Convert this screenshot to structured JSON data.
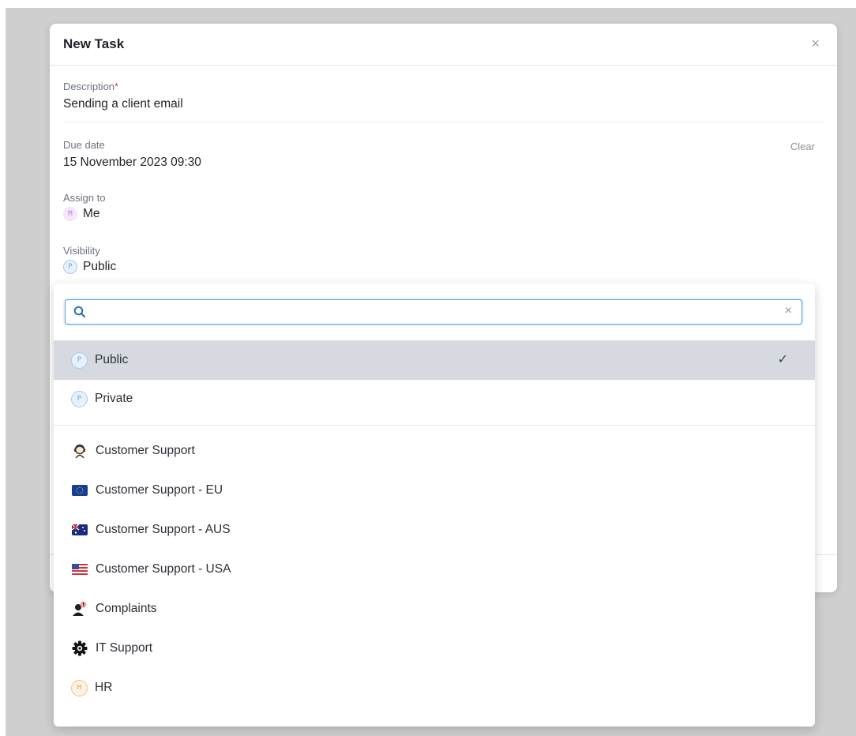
{
  "modal": {
    "title": "New Task",
    "close_label": "×",
    "description": {
      "label": "Description",
      "required_mark": "*",
      "value": "Sending a client email"
    },
    "due_date": {
      "label": "Due date",
      "value": "15 November 2023 09:30",
      "clear_label": "Clear"
    },
    "assign_to": {
      "label": "Assign to",
      "chip": "M",
      "value": "Me"
    },
    "visibility": {
      "label": "Visibility",
      "chip": "P",
      "value": "Public"
    }
  },
  "dropdown": {
    "search": {
      "value": "",
      "clear_label": "×"
    },
    "options": [
      {
        "label": "Public",
        "chip": "P",
        "icon": "public-chip",
        "selected": true,
        "check": "✓"
      },
      {
        "label": "Private",
        "chip": "P",
        "icon": "private-chip"
      },
      {
        "label": "Customer Support",
        "icon": "support-agent-icon"
      },
      {
        "label": "Customer Support - EU",
        "icon": "eu-flag-icon"
      },
      {
        "label": "Customer Support - AUS",
        "icon": "australia-flag-icon"
      },
      {
        "label": "Customer Support - USA",
        "icon": "usa-flag-icon"
      },
      {
        "label": "Complaints",
        "icon": "complaints-person-icon"
      },
      {
        "label": "IT Support",
        "icon": "gear-icon"
      },
      {
        "label": "HR",
        "chip": "H",
        "icon": "hr-chip"
      }
    ]
  },
  "colors": {
    "accent": "#5aa0e0",
    "selected_bg": "#d6dae0",
    "required": "#e0443e"
  }
}
